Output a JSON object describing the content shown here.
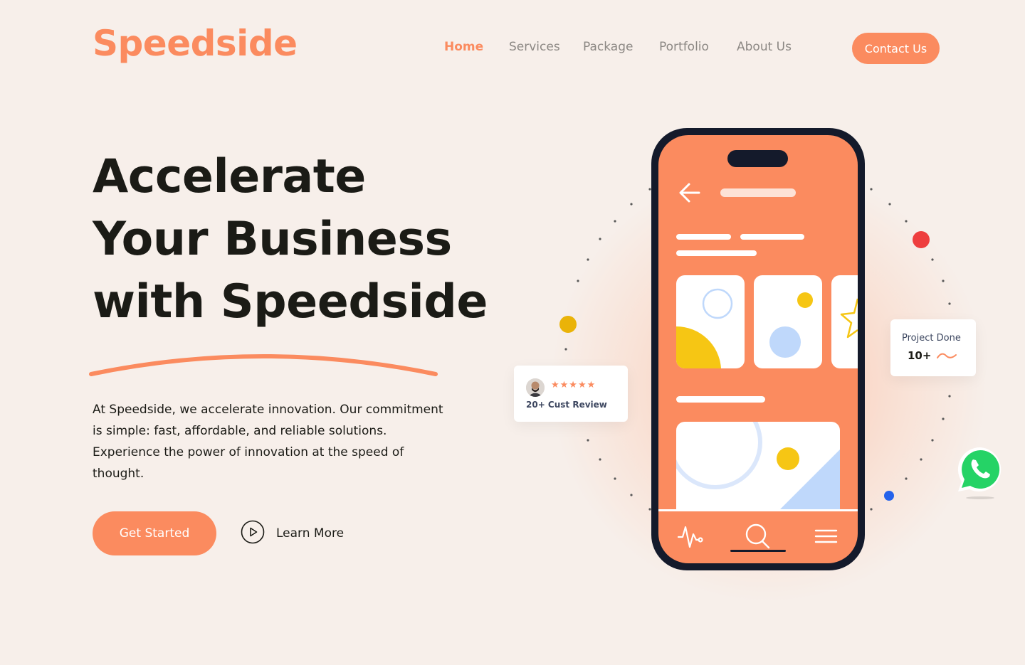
{
  "brand": {
    "name": "Speedside",
    "accent": "#fb8b5f"
  },
  "nav": {
    "items": [
      {
        "label": "Home",
        "active": true
      },
      {
        "label": "Services",
        "active": false
      },
      {
        "label": "Package",
        "active": false
      },
      {
        "label": "Portfolio",
        "active": false
      },
      {
        "label": "About Us",
        "active": false
      }
    ],
    "contact_label": "Contact Us"
  },
  "hero": {
    "title_lines": [
      "Accelerate",
      "Your Business",
      "with Speedside"
    ],
    "description": "At Speedside, we accelerate innovation. Our commitment is simple: fast, affordable, and reliable solutions. Experience the power of innovation at the speed of thought.",
    "cta_label": "Get Started",
    "learn_more_label": "Learn More",
    "learn_more_icon": "play-circle-icon"
  },
  "review_card": {
    "stars": "★★★★★",
    "rating": 5,
    "text": "20+ Cust Review"
  },
  "project_card": {
    "label": "Project Done",
    "value": "10+"
  },
  "phone_icons": [
    "back-arrow-icon",
    "pulse-icon",
    "search-icon",
    "menu-icon"
  ],
  "whatsapp_icon": "whatsapp-icon",
  "colors": {
    "background": "#f7efea",
    "dark": "#1b1b16",
    "phone_screen": "#fb8b5f",
    "phone_frame": "#141a2b",
    "yellow": "#f6c614",
    "light_blue": "#bfd8fb",
    "red_dot": "#ee3e3e",
    "blue_dot": "#2563eb",
    "whatsapp_green": "#25d366"
  }
}
